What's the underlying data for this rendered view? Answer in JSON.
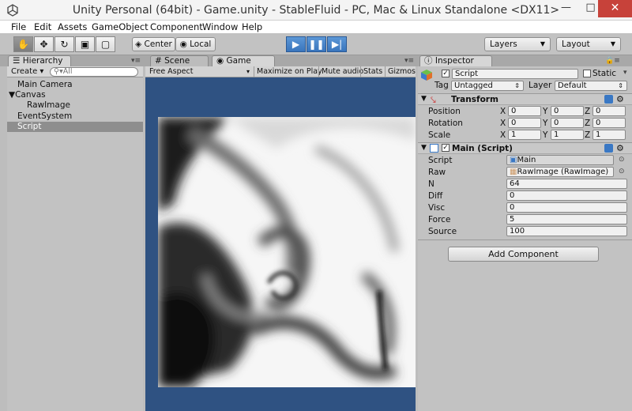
{
  "window": {
    "title": "Unity Personal (64bit) - Game.unity - StableFluid - PC, Mac & Linux Standalone <DX11>"
  },
  "menu": [
    "File",
    "Edit",
    "Assets",
    "GameObject",
    "Component",
    "Window",
    "Help"
  ],
  "toolbar": {
    "center": "Center",
    "local": "Local",
    "layers": "Layers",
    "layout": "Layout"
  },
  "hierarchy": {
    "tab": "Hierarchy",
    "create": "Create",
    "search_placeholder": "All",
    "items": [
      "Main Camera",
      "Canvas",
      "RawImage",
      "EventSystem",
      "Script"
    ],
    "selected": "Script"
  },
  "scene_tab": "Scene",
  "game": {
    "tab": "Game",
    "aspect": "Free Aspect",
    "options": [
      "Maximize on Play",
      "Mute audio",
      "Stats",
      "Gizmos"
    ]
  },
  "inspector": {
    "tab": "Inspector",
    "object_name": "Script",
    "static_label": "Static",
    "tag_label": "Tag",
    "tag_value": "Untagged",
    "layer_label": "Layer",
    "layer_value": "Default",
    "transform": {
      "title": "Transform",
      "rows": [
        {
          "label": "Position",
          "x": "0",
          "y": "0",
          "z": "0"
        },
        {
          "label": "Rotation",
          "x": "0",
          "y": "0",
          "z": "0"
        },
        {
          "label": "Scale",
          "x": "1",
          "y": "1",
          "z": "1"
        }
      ]
    },
    "component": {
      "title": "Main (Script)",
      "fields": [
        {
          "label": "Script",
          "value": "Main"
        },
        {
          "label": "Raw",
          "value": "RawImage (RawImage)"
        },
        {
          "label": "N",
          "value": "64"
        },
        {
          "label": "Diff",
          "value": "0"
        },
        {
          "label": "Visc",
          "value": "0"
        },
        {
          "label": "Force",
          "value": "5"
        },
        {
          "label": "Source",
          "value": "100"
        }
      ]
    },
    "add_component": "Add Component"
  },
  "colors": {
    "game_bg": "#2f5282",
    "play_blue": "#3c7bc6",
    "selected_row": "#8e8e8e"
  }
}
